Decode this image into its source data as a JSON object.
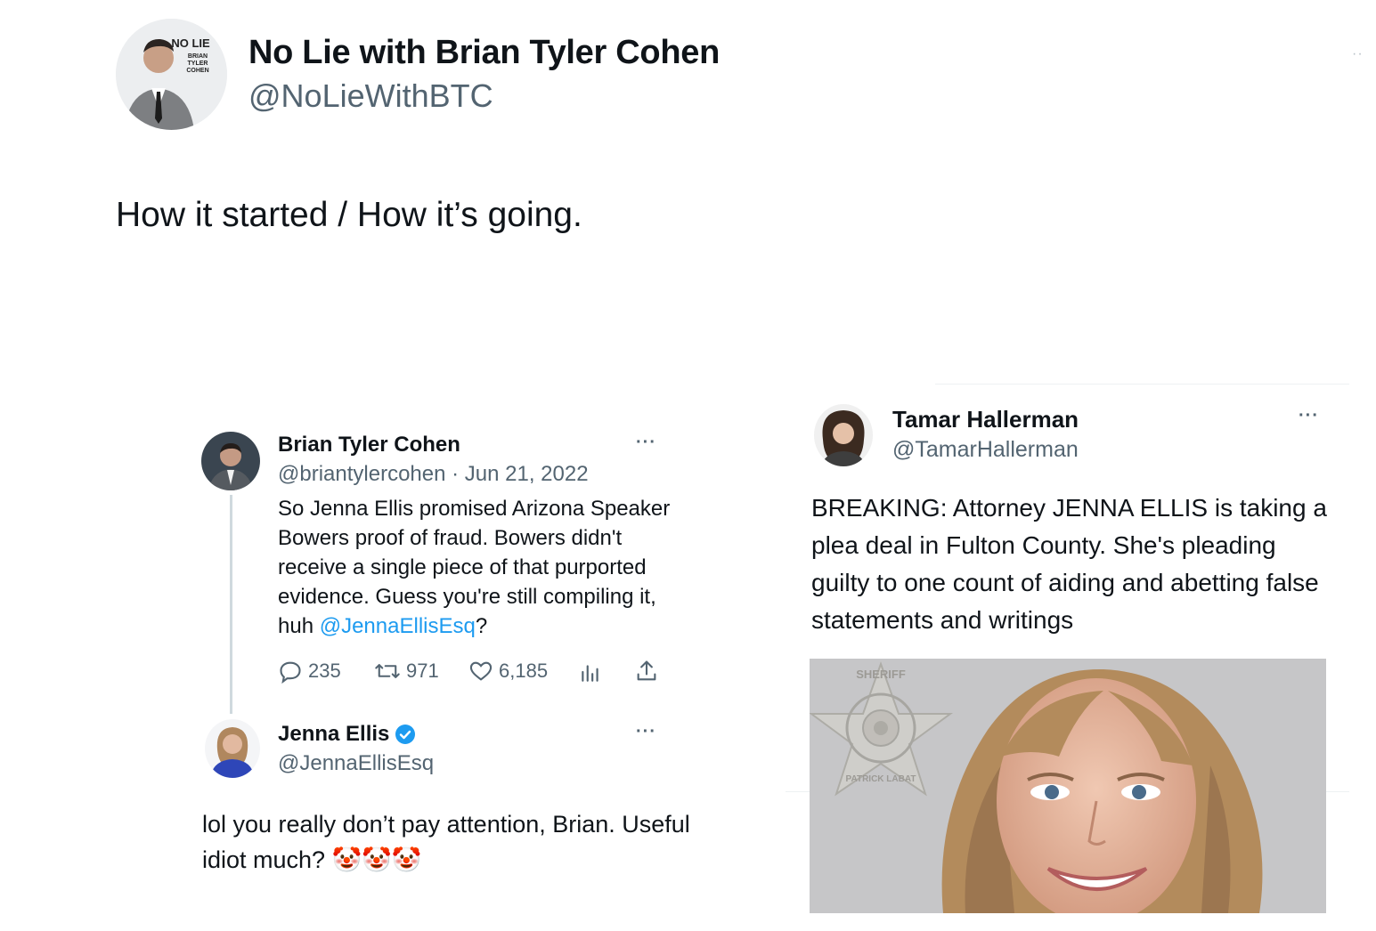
{
  "post": {
    "author_name": "No Lie with Brian Tyler Cohen",
    "author_handle": "@NoLieWithBTC",
    "avatar_logo": "NO LIE with BRIAN TYLER COHEN",
    "text": "How it started / How it’s going."
  },
  "left_screenshot": {
    "tweet": {
      "name": "Brian Tyler Cohen",
      "meta": "@briantylercohen · Jun 21, 2022",
      "body": "So Jenna Ellis promised Arizona Speaker Bowers proof of fraud. Bowers didn't receive a single piece of that purported evidence. Guess you're still compiling it, huh ",
      "mention": "@JennaEllisEsq",
      "body_end": "?",
      "replies": "235",
      "retweets": "971",
      "likes": "6,185"
    },
    "reply": {
      "name": "Jenna Ellis",
      "handle": "@JennaEllisEsq",
      "verified_color": "#1d9bf0",
      "body": "lol you really don’t pay attention, Brian. Useful idiot much? 🤡🤡🤡"
    }
  },
  "right_screenshot": {
    "name": "Tamar Hallerman",
    "handle": "@TamarHallerman",
    "body": "BREAKING: Attorney JENNA ELLIS is taking a plea deal in Fulton County. She's pleading guilty to one count of aiding and abetting false statements and writings",
    "badge_text": "SHERIFF FULTON COUNTY · SHERIFF'S OFFICE · PATRICK LABAT"
  },
  "icons": [
    "more-icon",
    "reply-icon",
    "retweet-icon",
    "like-icon",
    "analytics-icon",
    "share-icon",
    "verified-icon"
  ],
  "colors": {
    "link": "#1d9bf0",
    "secondary_text": "#536471",
    "thread_line": "#cfd9de"
  }
}
